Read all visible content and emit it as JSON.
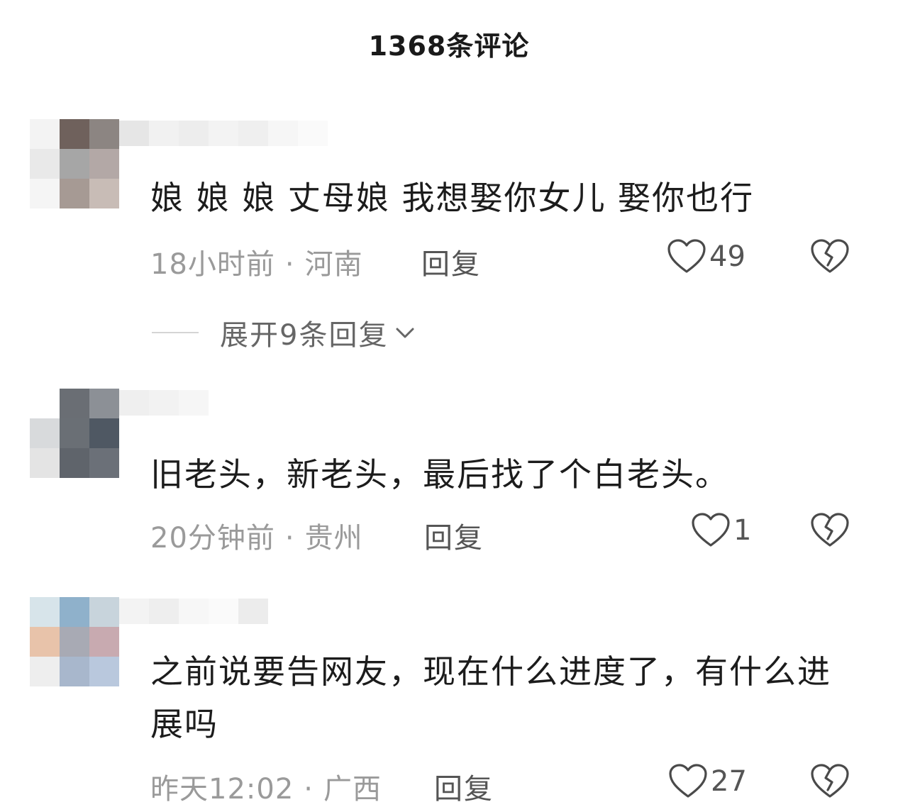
{
  "header": {
    "title": "1368条评论"
  },
  "comments": [
    {
      "text": "娘 娘 娘 丈母娘 我想娶你女儿  娶你也行",
      "time": "18小时前",
      "location": "河南",
      "reply_label": "回复",
      "likes": "49",
      "expand_label": "展开9条回复"
    },
    {
      "text": "旧老头，新老头，最后找了个白老头。",
      "time": "20分钟前",
      "location": "贵州",
      "reply_label": "回复",
      "likes": "1"
    },
    {
      "text": "之前说要告网友，现在什么进度了，有什么进展吗",
      "time": "昨天12:02",
      "location": "广西",
      "reply_label": "回复",
      "likes": "27"
    }
  ],
  "icons": {
    "like": "heart-outline-icon",
    "dislike": "broken-heart-icon",
    "expand": "chevron-down-icon"
  },
  "colors": {
    "text": "#1c1c1c",
    "meta": "#9a9a9a",
    "action": "#555555"
  }
}
